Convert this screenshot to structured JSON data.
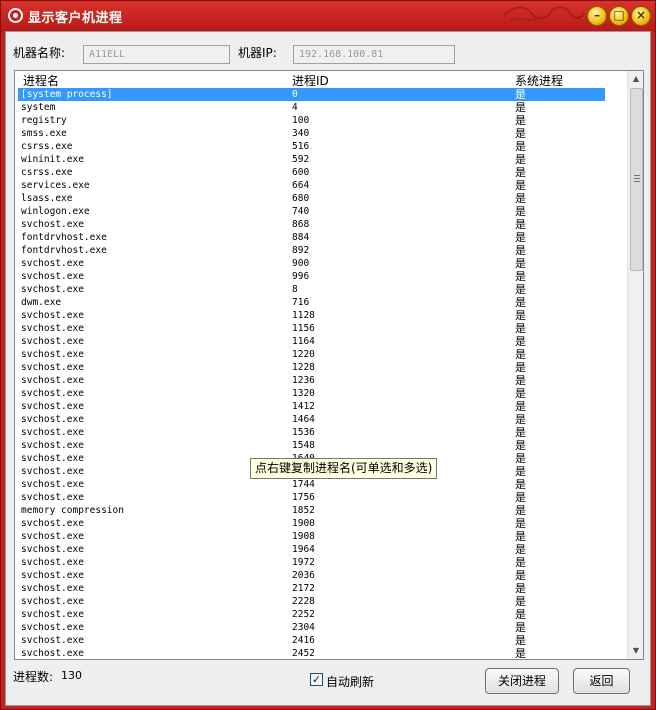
{
  "window": {
    "title": "显示客户机进程"
  },
  "machine": {
    "name_label": "机器名称:",
    "name_value": "A11ELL",
    "ip_label": "机器IP:",
    "ip_value": "192.168.100.81"
  },
  "table": {
    "headers": {
      "name": "进程名",
      "pid": "进程ID",
      "system": "系统进程"
    },
    "rows": [
      [
        "[system process]",
        "0",
        "是"
      ],
      [
        "system",
        "4",
        "是"
      ],
      [
        "registry",
        "100",
        "是"
      ],
      [
        "smss.exe",
        "340",
        "是"
      ],
      [
        "csrss.exe",
        "516",
        "是"
      ],
      [
        "wininit.exe",
        "592",
        "是"
      ],
      [
        "csrss.exe",
        "600",
        "是"
      ],
      [
        "services.exe",
        "664",
        "是"
      ],
      [
        "lsass.exe",
        "680",
        "是"
      ],
      [
        "winlogon.exe",
        "740",
        "是"
      ],
      [
        "svchost.exe",
        "868",
        "是"
      ],
      [
        "fontdrvhost.exe",
        "884",
        "是"
      ],
      [
        "fontdrvhost.exe",
        "892",
        "是"
      ],
      [
        "svchost.exe",
        "900",
        "是"
      ],
      [
        "svchost.exe",
        "996",
        "是"
      ],
      [
        "svchost.exe",
        "8",
        "是"
      ],
      [
        "dwm.exe",
        "716",
        "是"
      ],
      [
        "svchost.exe",
        "1128",
        "是"
      ],
      [
        "svchost.exe",
        "1156",
        "是"
      ],
      [
        "svchost.exe",
        "1164",
        "是"
      ],
      [
        "svchost.exe",
        "1220",
        "是"
      ],
      [
        "svchost.exe",
        "1228",
        "是"
      ],
      [
        "svchost.exe",
        "1236",
        "是"
      ],
      [
        "svchost.exe",
        "1320",
        "是"
      ],
      [
        "svchost.exe",
        "1412",
        "是"
      ],
      [
        "svchost.exe",
        "1464",
        "是"
      ],
      [
        "svchost.exe",
        "1536",
        "是"
      ],
      [
        "svchost.exe",
        "1548",
        "是"
      ],
      [
        "svchost.exe",
        "1640",
        "是"
      ],
      [
        "svchost.exe",
        "",
        "是"
      ],
      [
        "svchost.exe",
        "1744",
        "是"
      ],
      [
        "svchost.exe",
        "1756",
        "是"
      ],
      [
        "memory compression",
        "1852",
        "是"
      ],
      [
        "svchost.exe",
        "1900",
        "是"
      ],
      [
        "svchost.exe",
        "1908",
        "是"
      ],
      [
        "svchost.exe",
        "1964",
        "是"
      ],
      [
        "svchost.exe",
        "1972",
        "是"
      ],
      [
        "svchost.exe",
        "2036",
        "是"
      ],
      [
        "svchost.exe",
        "2172",
        "是"
      ],
      [
        "svchost.exe",
        "2228",
        "是"
      ],
      [
        "svchost.exe",
        "2252",
        "是"
      ],
      [
        "svchost.exe",
        "2304",
        "是"
      ],
      [
        "svchost.exe",
        "2416",
        "是"
      ],
      [
        "svchost.exe",
        "2452",
        "是"
      ]
    ],
    "selected_index": 0
  },
  "tooltip": "点右键复制进程名(可单选和多选)",
  "footer": {
    "count_label": "进程数:",
    "count_value": "130",
    "auto_refresh_label": "自动刷新",
    "auto_refresh_checked": true,
    "close_process_button": "关闭进程",
    "back_button": "返回"
  },
  "colors": {
    "title_bar": "#c8201c",
    "selection": "#3399ff"
  }
}
